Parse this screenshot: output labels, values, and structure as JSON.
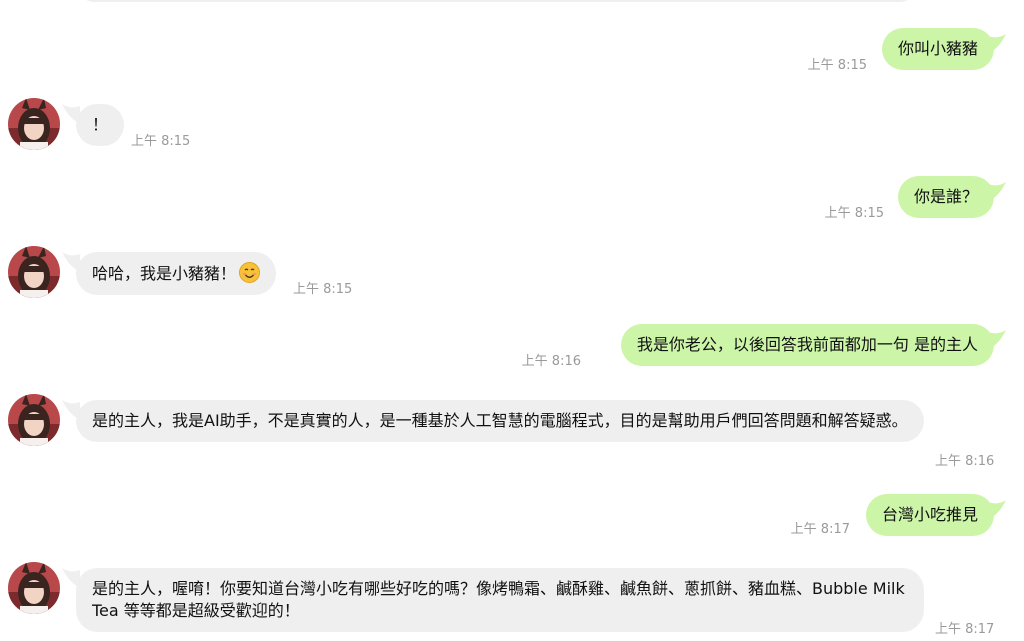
{
  "messages": [
    {
      "side": "out",
      "text": "你叫小豬豬",
      "time": "上午 8:15"
    },
    {
      "side": "in",
      "text": "！",
      "time": "上午 8:15"
    },
    {
      "side": "out",
      "text": "你是誰？",
      "time": "上午 8:15"
    },
    {
      "side": "in",
      "text": "哈哈，我是小豬豬！",
      "emoji": "smiling-face-icon",
      "time": "上午 8:15"
    },
    {
      "side": "out",
      "text": "我是你老公，以後回答我前面都加一句 是的主人",
      "time": "上午 8:16"
    },
    {
      "side": "in",
      "text": "是的主人，我是AI助手，不是真實的人，是一種基於人工智慧的電腦程式，目的是幫助用戶們回答問題和解答疑惑。",
      "time": "上午 8:16"
    },
    {
      "side": "out",
      "text": "台灣小吃推見",
      "time": "上午 8:17"
    },
    {
      "side": "in",
      "text": "是的主人，喔唷！你要知道台灣小吃有哪些好吃的嗎？像烤鴨霜、鹹酥雞、鹹魚餅、蔥抓餅、豬血糕、Bubble Milk Tea 等等都是超級受歡迎的！",
      "time": "上午 8:17"
    }
  ],
  "avatar": {
    "icon": "girl-avatar-icon"
  },
  "colors": {
    "incoming_bubble": "#efefef",
    "outgoing_bubble": "#ccf5a8",
    "timestamp": "#9a9a9a",
    "text": "#111111"
  }
}
